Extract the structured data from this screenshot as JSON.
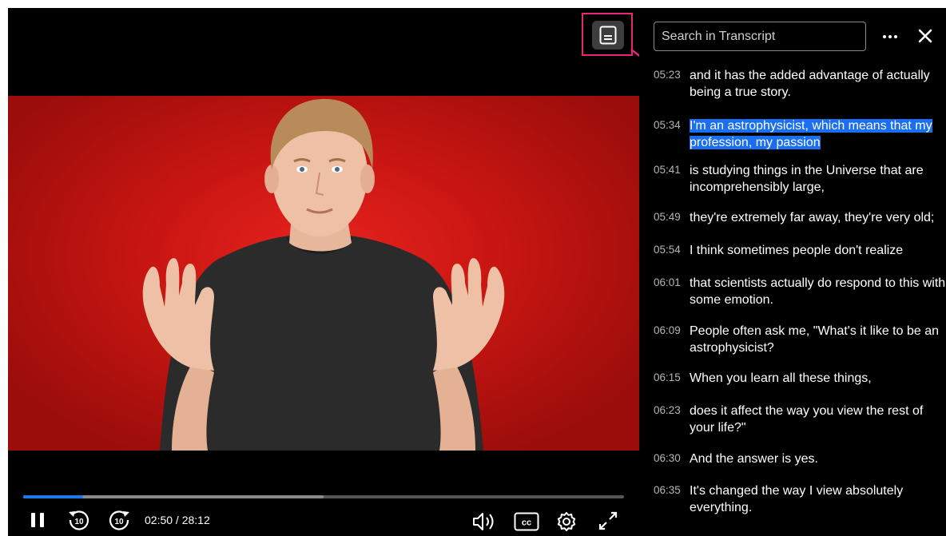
{
  "player": {
    "current_time": "02:50",
    "duration": "28:12",
    "time_display": "02:50 / 28:12",
    "played_fraction": 0.1,
    "buffered_fraction": 0.5
  },
  "transcript": {
    "search_placeholder": "Search in Transcript",
    "highlight_color": "#1a6ef0",
    "entries": [
      {
        "time": "05:23",
        "text": "and it has the added advantage of actually being a true story."
      },
      {
        "time": "05:34",
        "text": "I'm an astrophysicist, which means that my profession, my passion",
        "highlighted": true
      },
      {
        "time": "05:41",
        "text": "is studying things in the Universe that are incomprehensibly large,"
      },
      {
        "time": "05:49",
        "text": "they're extremely far away, they're very old;"
      },
      {
        "time": "05:54",
        "text": "I think sometimes people don't realize"
      },
      {
        "time": "06:01",
        "text": "that scientists actually do respond to this with some emotion."
      },
      {
        "time": "06:09",
        "text": "People often ask me, \"What's it like to be an astrophysicist?"
      },
      {
        "time": "06:15",
        "text": "When you learn all these things,"
      },
      {
        "time": "06:23",
        "text": "does it affect the way you view the rest of your life?\""
      },
      {
        "time": "06:30",
        "text": "And the answer is yes."
      },
      {
        "time": "06:35",
        "text": "It's changed the way I view absolutely everything."
      }
    ]
  },
  "icons": {
    "transcript_toggle": "transcript-icon",
    "pause": "pause-icon",
    "rewind": "rewind-10-icon",
    "forward": "forward-10-icon",
    "volume": "volume-icon",
    "captions": "closed-captions-icon",
    "settings": "gear-icon",
    "fullscreen": "fullscreen-icon",
    "more": "more-icon",
    "close": "close-icon"
  },
  "colors": {
    "progress_played": "#1e7ae8",
    "toggle_outline": "#e8257a"
  }
}
